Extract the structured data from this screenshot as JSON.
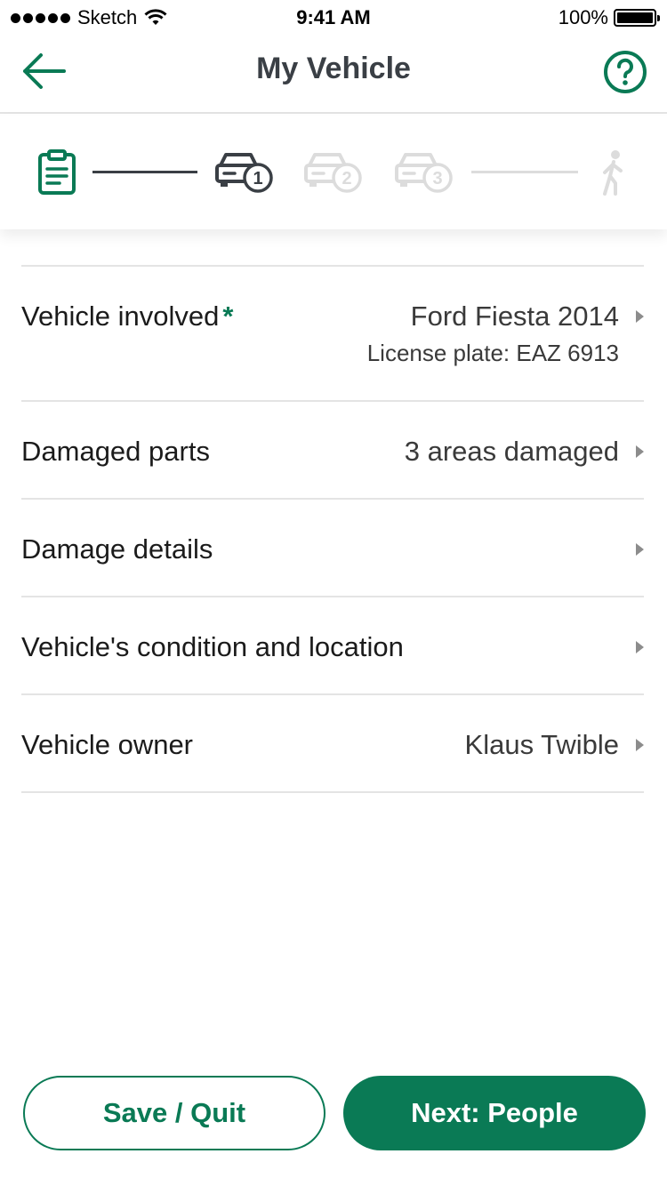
{
  "status_bar": {
    "carrier": "Sketch",
    "time": "9:41 AM",
    "battery": "100%"
  },
  "nav": {
    "title": "My Vehicle",
    "back_icon": "arrow-left-icon",
    "help_icon": "question-circle-icon"
  },
  "stepper": {
    "steps": [
      {
        "icon": "clipboard-icon",
        "state": "complete"
      },
      {
        "icon": "car-icon",
        "badge": "1",
        "state": "current"
      },
      {
        "icon": "car-icon",
        "badge": "2",
        "state": "upcoming"
      },
      {
        "icon": "car-icon",
        "badge": "3",
        "state": "upcoming"
      },
      {
        "icon": "pedestrian-icon",
        "state": "upcoming"
      }
    ]
  },
  "rows": [
    {
      "label": "Vehicle involved",
      "required": "*",
      "value": "Ford Fiesta 2014",
      "sub": "License plate: EAZ 6913"
    },
    {
      "label": "Damaged parts",
      "value": "3 areas damaged"
    },
    {
      "label": "Damage details",
      "value": ""
    },
    {
      "label": "Vehicle's condition and location",
      "value": ""
    },
    {
      "label": "Vehicle owner",
      "value": "Klaus Twible"
    }
  ],
  "buttons": {
    "save": "Save / Quit",
    "next": "Next: People"
  },
  "colors": {
    "accent": "#0a7a55",
    "current_step": "#3a3f45",
    "upcoming_step": "#dcdcdc",
    "divider": "#e4e4e4"
  }
}
